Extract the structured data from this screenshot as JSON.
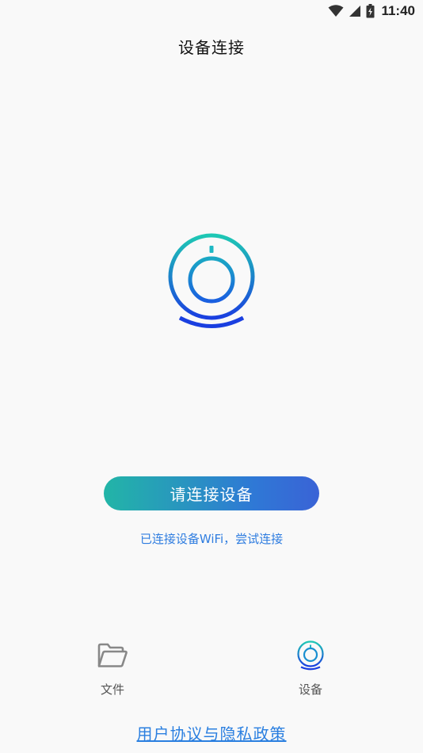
{
  "status_bar": {
    "time": "11:40",
    "icons": [
      "wifi-icon",
      "signal-icon",
      "battery-icon"
    ]
  },
  "header": {
    "title": "设备连接"
  },
  "main": {
    "logo_icon": "camera-device-icon",
    "connect_button_label": "请连接设备",
    "wifi_hint": "已连接设备WiFi，尝试连接"
  },
  "tabs": [
    {
      "label": "文件",
      "icon": "folder-icon",
      "active": false
    },
    {
      "label": "设备",
      "icon": "camera-device-icon",
      "active": true
    }
  ],
  "footer": {
    "policy_link": "用户协议与隐私政策"
  },
  "colors": {
    "accent_start": "#22b5a7",
    "accent_end": "#3a63d6",
    "link": "#2a7fe0",
    "logo_teal": "#1ec8b4",
    "logo_blue": "#1a3fe0"
  }
}
